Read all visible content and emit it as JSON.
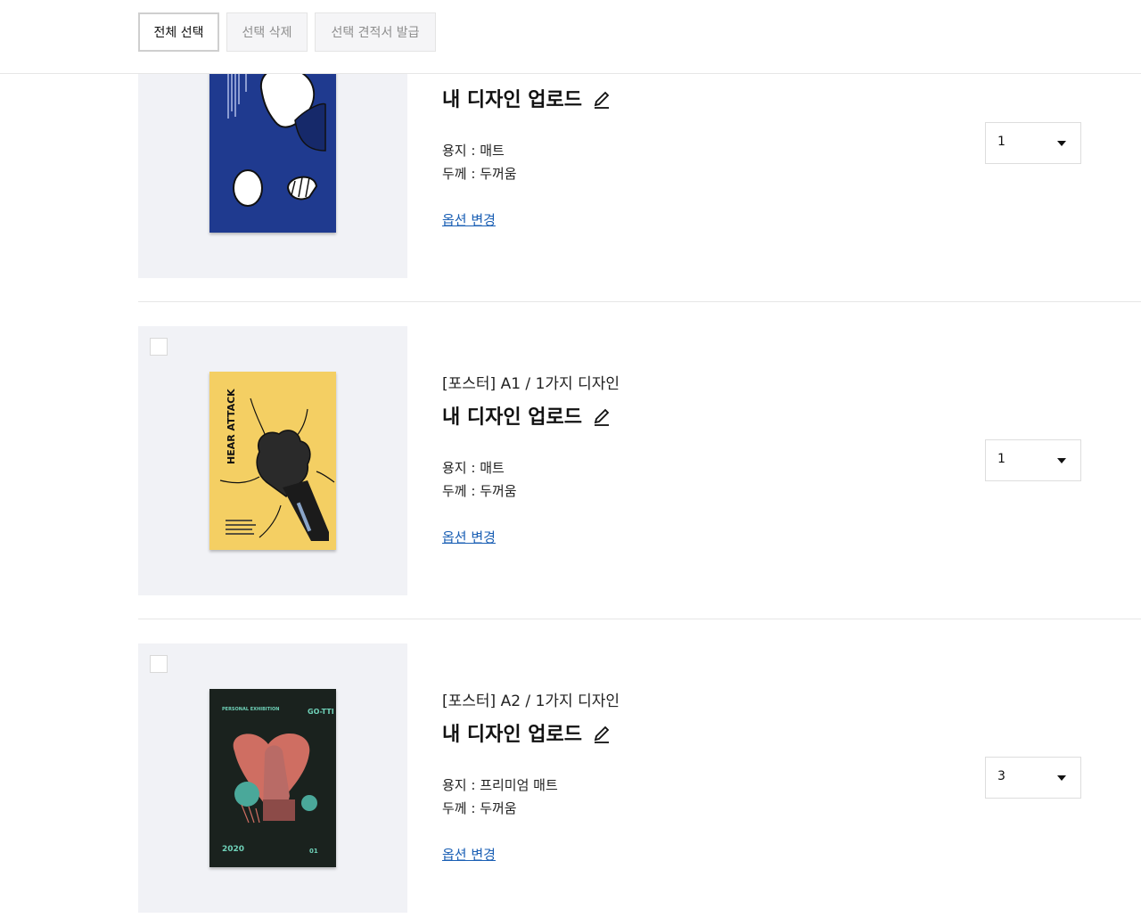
{
  "toolbar": {
    "select_all": "전체 선택",
    "delete_selected": "선택 삭제",
    "issue_quote": "선택 견적서 발급"
  },
  "items": [
    {
      "spec": "",
      "title": "내 디자인 업로드",
      "paper_label": "용지 : 매트",
      "thickness_label": "두께 : 두꺼움",
      "option_change": "옵션 변경",
      "quantity": "1",
      "poster_color": "#1f3a8f"
    },
    {
      "spec": "[포스터] A1 / 1가지 디자인",
      "title": "내 디자인 업로드",
      "paper_label": "용지 : 매트",
      "thickness_label": "두께 : 두꺼움",
      "option_change": "옵션 변경",
      "quantity": "1",
      "poster_color": "#f4cf63",
      "poster_text": {
        "headline": "HEAR ATTACK",
        "body": "Lorem vel studio service heart attack that ruin coracle as, but also falling in love."
      }
    },
    {
      "spec": "[포스터] A2 / 1가지 디자인",
      "title": "내 디자인 업로드",
      "paper_label": "용지 : 프리미엄 매트",
      "thickness_label": "두께 : 두꺼움",
      "option_change": "옵션 변경",
      "quantity": "3",
      "poster_color": "#1a221e",
      "poster_text": {
        "tag": "PERSONAL EXHIBITION",
        "name": "GO-TTI",
        "year": "2020",
        "issue": "01"
      }
    }
  ],
  "colors": {
    "link": "#1a5fb4",
    "thumb_bg": "#f1f2f6",
    "divider": "#e6e6e6"
  }
}
